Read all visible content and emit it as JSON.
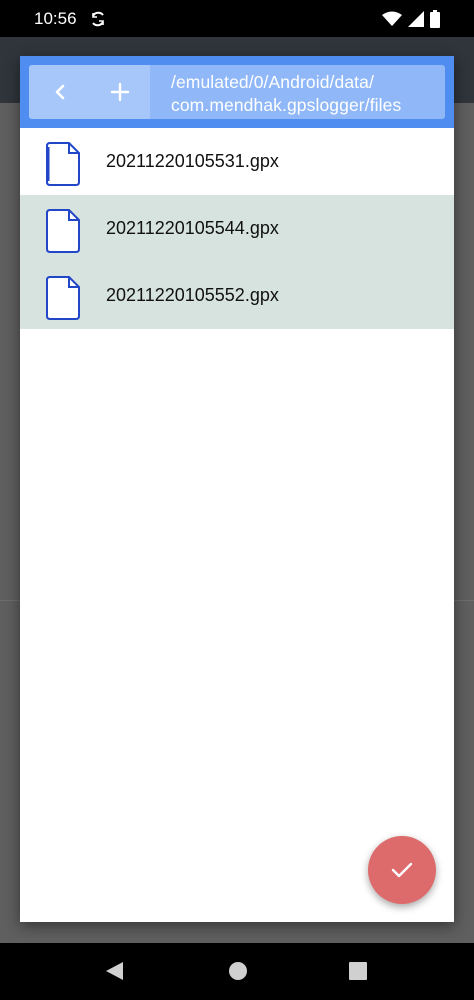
{
  "status_bar": {
    "time": "10:56",
    "icons": [
      "sync-icon",
      "wifi-icon",
      "signal-icon",
      "battery-icon"
    ]
  },
  "dialog": {
    "path_lines": [
      "/emulated/0/Android/data/",
      "com.mendhak.gpslogger/files"
    ],
    "back_icon": "chevron-left-icon",
    "new_folder_icon": "plus-icon",
    "files": [
      {
        "name": "20211220105531.gpx",
        "selected": false,
        "icon": "file-icon"
      },
      {
        "name": "20211220105544.gpx",
        "selected": true,
        "icon": "file-icon"
      },
      {
        "name": "20211220105552.gpx",
        "selected": true,
        "icon": "file-icon"
      }
    ],
    "confirm_icon": "check-icon"
  },
  "colors": {
    "header": "#4f8ef0",
    "selected_row": "#d6e3df",
    "fab": "#de6b6b",
    "file_icon_stroke": "#2146c7"
  },
  "nav_bar": {
    "icons": [
      "back-triangle-icon",
      "home-circle-icon",
      "recents-square-icon"
    ]
  }
}
